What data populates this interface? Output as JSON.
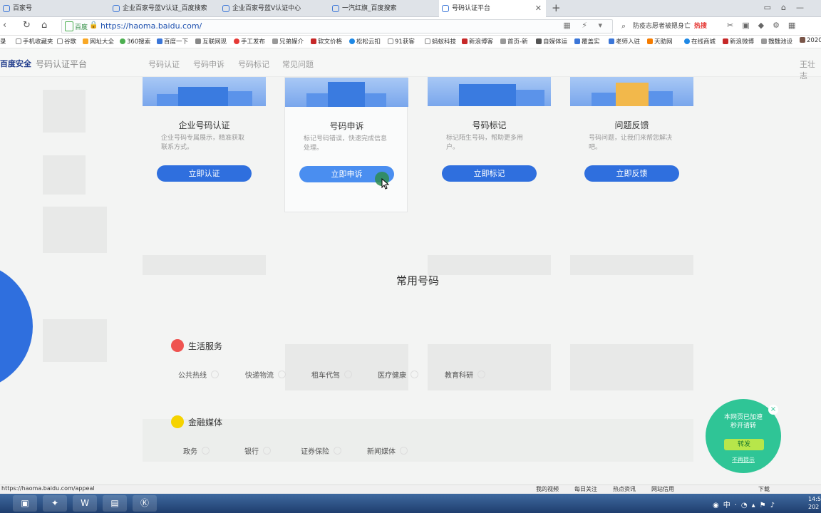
{
  "browser": {
    "tabs": [
      {
        "label": "百家号"
      },
      {
        "label": "企业百家号蓝V认证_百度搜索"
      },
      {
        "label": "企业百家号蓝V认证中心"
      },
      {
        "label": "一汽红旗_百度搜索"
      },
      {
        "label": "号码认证平台"
      }
    ],
    "new_tab": "+",
    "address": {
      "site_label": "百度",
      "url": "https://haoma.baidu.com/"
    },
    "search": {
      "text": "防疫志愿者被摁身亡",
      "hot_label": "热搜"
    },
    "bookmarks": [
      {
        "label": "录"
      },
      {
        "label": "手机收藏夹"
      },
      {
        "label": "谷歌"
      },
      {
        "label": "网址大全"
      },
      {
        "label": "360搜索"
      },
      {
        "label": "百度一下"
      },
      {
        "label": "互联网现"
      },
      {
        "label": "手工发布"
      },
      {
        "label": "兄弟媒介"
      },
      {
        "label": "软文价格"
      },
      {
        "label": "松松云扣"
      },
      {
        "label": "91获客"
      },
      {
        "label": "蚂蚁科技"
      },
      {
        "label": "新浪博客"
      },
      {
        "label": "首页-新"
      },
      {
        "label": "自媒体运"
      },
      {
        "label": "覆盖实"
      },
      {
        "label": "老师入驻"
      },
      {
        "label": "天助网"
      },
      {
        "label": "在线商城"
      },
      {
        "label": "新浪微博"
      },
      {
        "label": "魏魏池设"
      },
      {
        "label": "2020"
      }
    ]
  },
  "header": {
    "logo": "百度安全",
    "platform": "号码认证平台",
    "nav": [
      "号码认证",
      "号码申诉",
      "号码标记",
      "常见问题"
    ],
    "user": "王壮志"
  },
  "cards": [
    {
      "title": "企业号码认证",
      "desc": "企业号码专属展示，精准获取联系方式。",
      "button": "立即认证"
    },
    {
      "title": "号码申诉",
      "desc": "标记号码错误，快速完成信息处理。",
      "button": "立即申诉"
    },
    {
      "title": "号码标记",
      "desc": "标记陌生号码，帮助更多用户。",
      "button": "立即标记"
    },
    {
      "title": "问题反馈",
      "desc": "号码问题，让我们来帮您解决吧。",
      "button": "立即反馈"
    }
  ],
  "common_numbers": {
    "title": "常用号码",
    "categories": [
      {
        "name": "生活服务",
        "color": "#ef5350",
        "tags": [
          "公共热线",
          "快递物流",
          "租车代驾",
          "医疗健康",
          "教育科研"
        ]
      },
      {
        "name": "金融媒体",
        "color": "#f5d300",
        "tags": [
          "政务",
          "银行",
          "证券保险",
          "新闻媒体"
        ]
      }
    ]
  },
  "share_popup": {
    "line1": "本网页已加速",
    "line2": "秒开请转",
    "button": "转发",
    "dismiss": "不再提示",
    "close": "×"
  },
  "statusbar": {
    "url": "https://haoma.baidu.com/appeal",
    "items": [
      "我的视频",
      "每日关注",
      "热点资讯",
      "网站信用",
      "下载"
    ]
  },
  "taskbar": {
    "clock_time": "14:5",
    "clock_date": "202"
  },
  "colors": {
    "primary": "#2f6fde",
    "share_green": "#2fc596"
  }
}
